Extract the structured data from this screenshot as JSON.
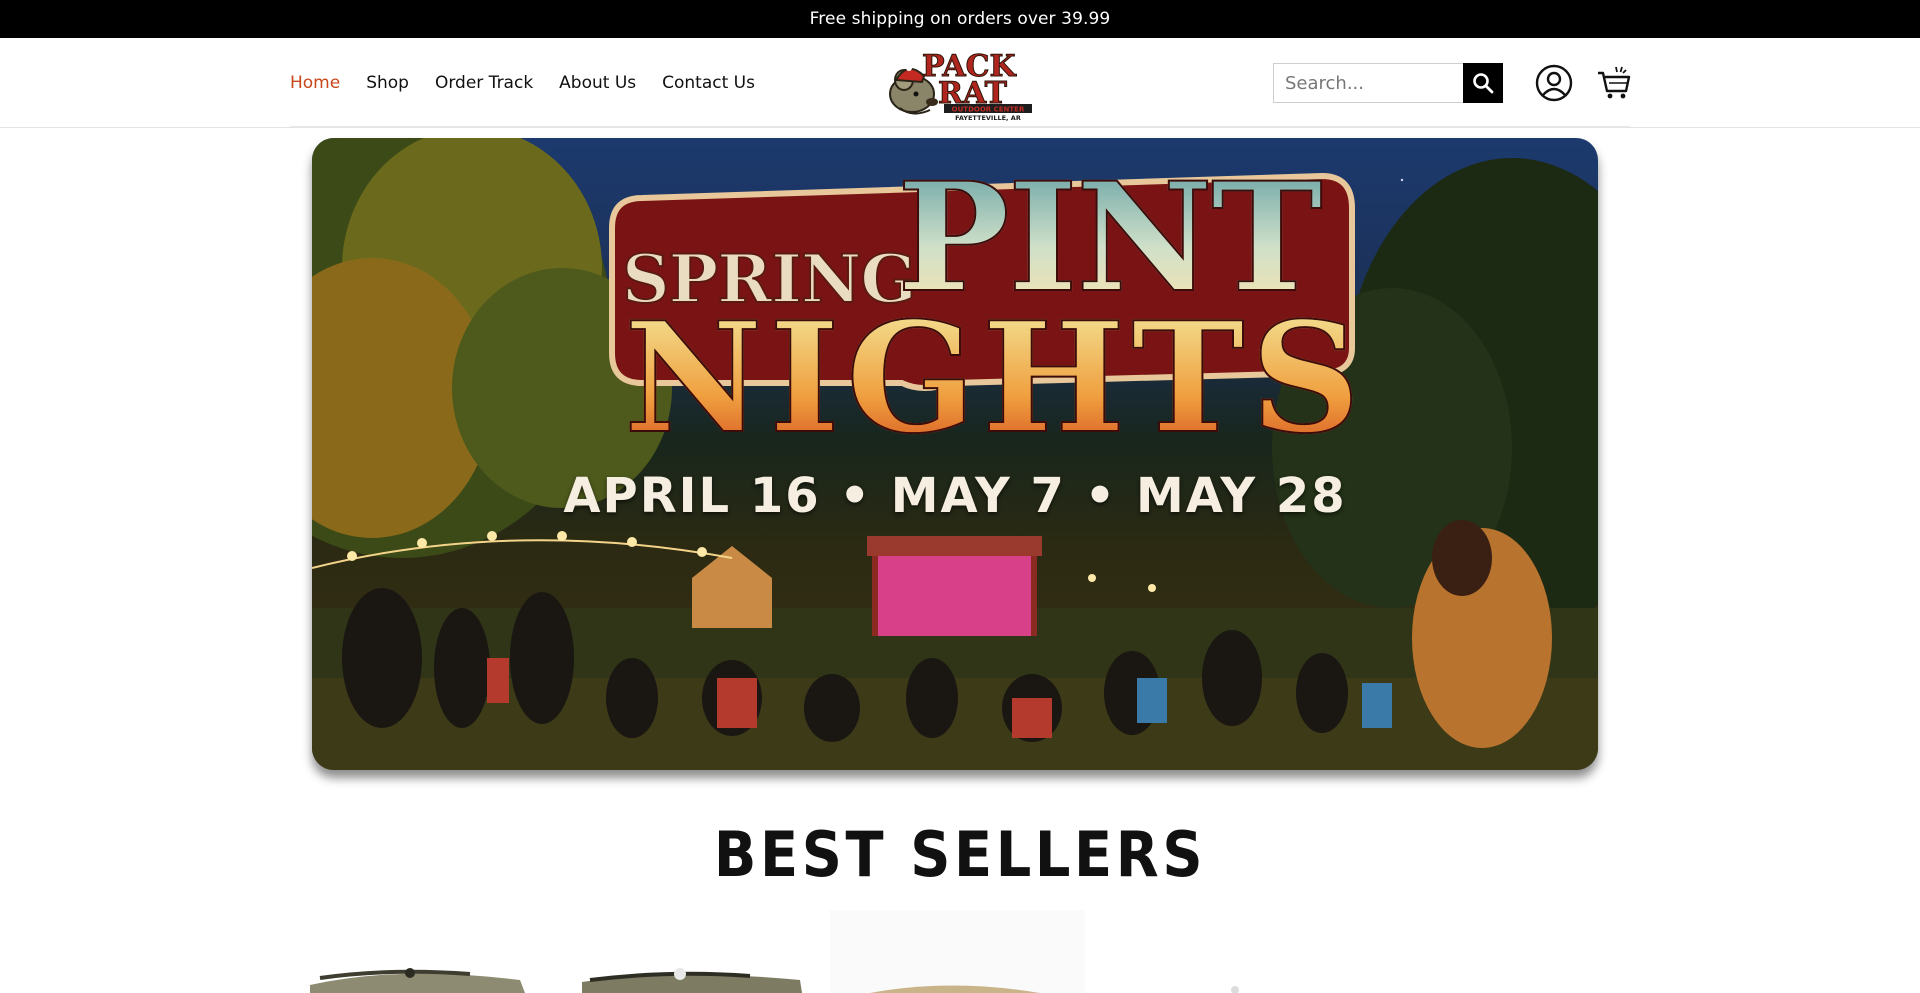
{
  "announcement": {
    "text": "Free shipping on orders over 39.99"
  },
  "nav": {
    "items": [
      {
        "label": "Home",
        "active": true
      },
      {
        "label": "Shop",
        "active": false
      },
      {
        "label": "Order Track",
        "active": false
      },
      {
        "label": "About Us",
        "active": false
      },
      {
        "label": "Contact Us",
        "active": false
      }
    ]
  },
  "brand": {
    "logo_line1": "PACK",
    "logo_line2": "RAT",
    "logo_sub": "OUTDOOR CENTER",
    "logo_location": "FAYETTEVILLE, AR"
  },
  "search": {
    "placeholder": "Search..."
  },
  "icons": {
    "search": "search-icon",
    "account": "user-circle-icon",
    "cart": "shopping-cart-icon"
  },
  "hero": {
    "word1": "SPRING",
    "word2": "PINT",
    "word3": "NIGHTS",
    "dates": "APRIL 16 • MAY 7 • MAY 28"
  },
  "sections": {
    "best_sellers_title": "BEST SELLERS"
  },
  "colors": {
    "accent": "#c8461b",
    "announcement_bg": "#000000",
    "text": "#111111"
  }
}
